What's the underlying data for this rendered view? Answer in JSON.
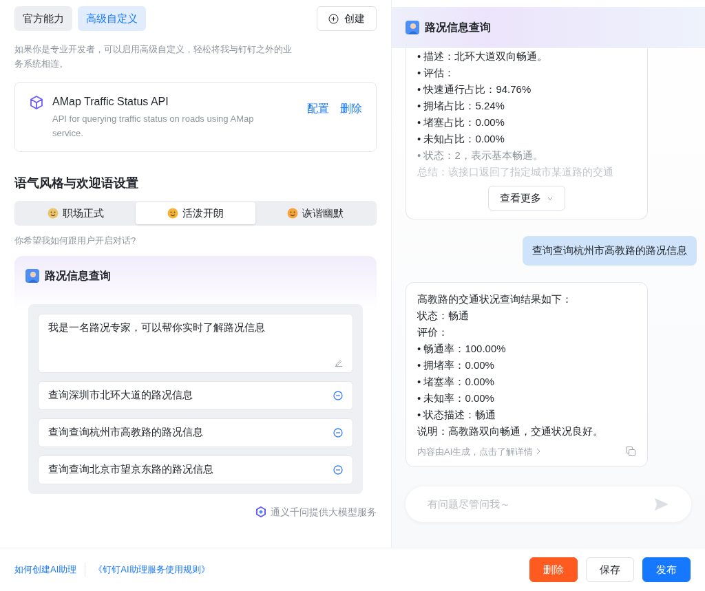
{
  "source_tabs": [
    {
      "label": "官方能力",
      "selected": false
    },
    {
      "label": "高级自定义",
      "selected": true
    }
  ],
  "create_button": "创建",
  "source_hint": "如果你是专业开发者，可以启用高级自定义，轻松将我与钉钉之外的业务系统相连。",
  "api_card": {
    "name": "AMap Traffic Status API",
    "description": "API for querying traffic status on roads using AMap service.",
    "actions": [
      "配置",
      "删除"
    ]
  },
  "tone_section": {
    "title": "语气风格与欢迎语设置",
    "tabs": [
      {
        "label": "职场正式",
        "selected": false
      },
      {
        "label": "活泼开朗",
        "selected": true
      },
      {
        "label": "诙谐幽默",
        "selected": false
      }
    ],
    "question": "你希望我如何跟用户开启对话?"
  },
  "preview": {
    "assistant_name": "路况信息查询",
    "greeting": "我是一名路况专家，可以帮你实时了解路况信息",
    "suggestions": [
      "查询深圳市北环大道的路况信息",
      "查询查询杭州市高教路的路况信息",
      "查询查询北京市望京东路的路况信息"
    ],
    "provider": "通义千问提供大模型服务"
  },
  "chat": {
    "assistant_name": "路况信息查询",
    "messages": [
      {
        "kind": "bot",
        "collapsed": true,
        "lines": [
          "• 描述：北环大道双向畅通。",
          "• 评估：",
          "• 快速通行占比：94.76%",
          "• 拥堵占比：5.24%",
          "• 堵塞占比：0.00%",
          "• 未知占比：0.00%",
          "• 状态：2，表示基本畅通。",
          "总结：该接口返回了指定城市某道路的交通"
        ],
        "more_button": "查看更多"
      },
      {
        "kind": "user",
        "text": "查询查询杭州市高教路的路况信息"
      },
      {
        "kind": "bot",
        "collapsed": false,
        "lines": [
          "高教路的交通状况查询结果如下：",
          "状态：畅通",
          "评价：",
          "• 畅通率：100.00%",
          "• 拥堵率：0.00%",
          "• 堵塞率：0.00%",
          "• 未知率：0.00%",
          "• 状态描述：畅通",
          "说明：高教路双向畅通，交通状况良好。"
        ],
        "footnote": "内容由AI生成，点击了解详情"
      }
    ],
    "input_placeholder": "有问题尽管问我～"
  },
  "footer": {
    "links": [
      "如何创建AI助理",
      "《钉钉AI助理服务使用规则》"
    ],
    "buttons": [
      {
        "kind": "danger",
        "label": "删除"
      },
      {
        "kind": "default",
        "label": "保存"
      },
      {
        "kind": "primary",
        "label": "发布"
      }
    ]
  }
}
